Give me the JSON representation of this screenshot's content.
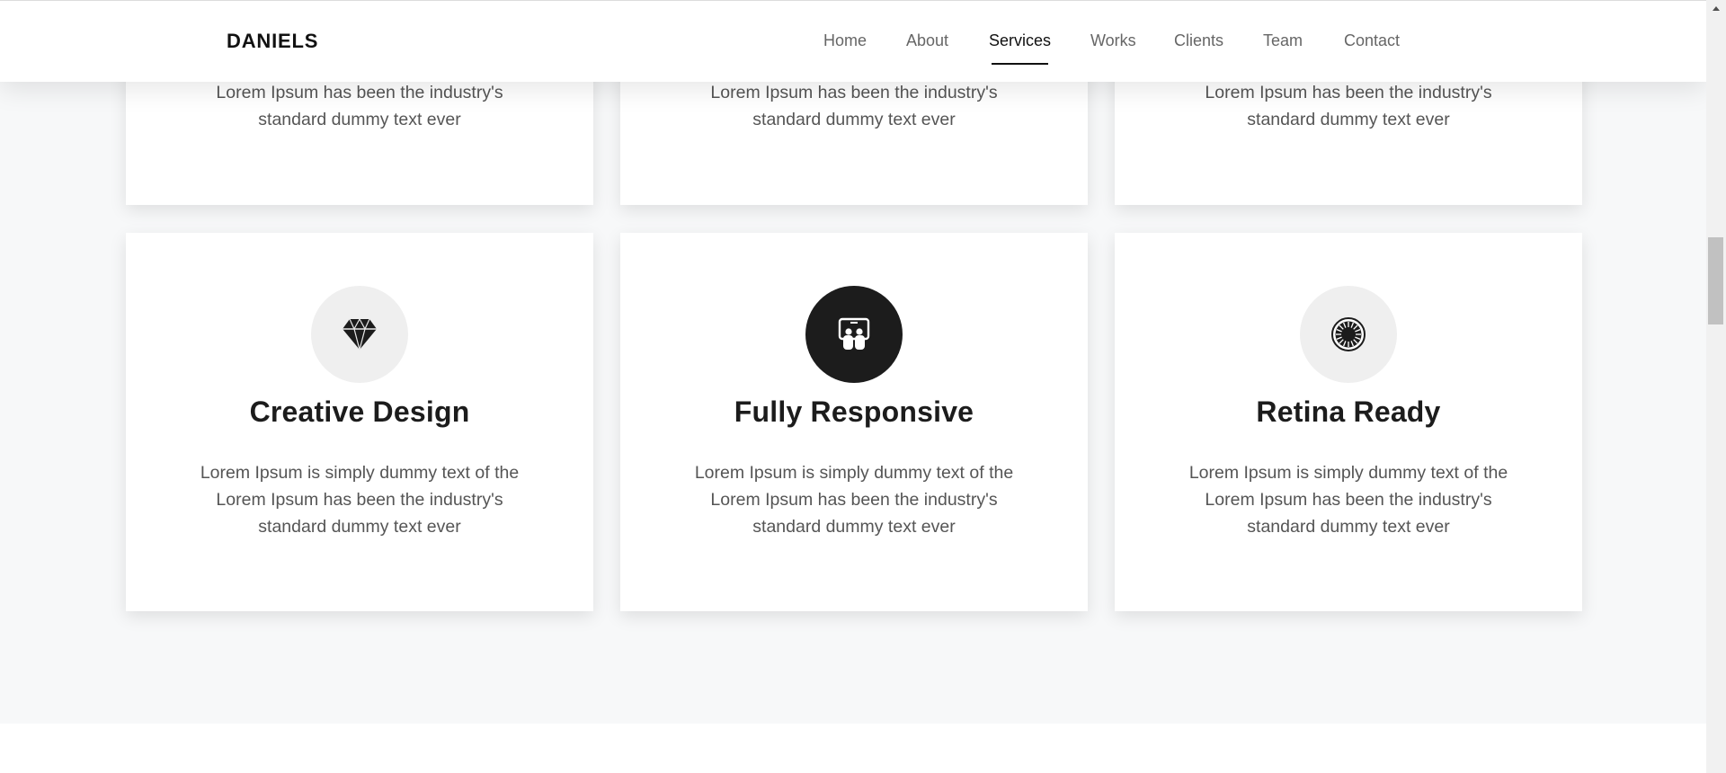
{
  "header": {
    "logo": "DANIELS",
    "nav": [
      {
        "label": "Home"
      },
      {
        "label": "About"
      },
      {
        "label": "Services",
        "active": true
      },
      {
        "label": "Works"
      },
      {
        "label": "Clients"
      },
      {
        "label": "Team"
      },
      {
        "label": "Contact"
      }
    ]
  },
  "services": {
    "top_row": [
      {
        "text": "Lorem Ipsum has been the industry's standard dummy text ever"
      },
      {
        "text": "Lorem Ipsum has been the industry's standard dummy text ever"
      },
      {
        "text": "Lorem Ipsum has been the industry's standard dummy text ever"
      }
    ],
    "cards": [
      {
        "title": "Creative Design",
        "text": "Lorem Ipsum is simply dummy text of the Lorem Ipsum has been the industry's standard dummy text ever",
        "icon": "diamond-icon"
      },
      {
        "title": "Fully Responsive",
        "text": "Lorem Ipsum is simply dummy text of the Lorem Ipsum has been the industry's standard dummy text ever",
        "icon": "responsive-devices-icon",
        "highlighted": true
      },
      {
        "title": "Retina Ready",
        "text": "Lorem Ipsum is simply dummy text of the Lorem Ipsum has been the industry's standard dummy text ever",
        "icon": "retina-eye-icon"
      }
    ]
  },
  "colors": {
    "section_background": "#f7f8f9",
    "card_background": "#ffffff",
    "heading": "#1c1c1c",
    "body_text": "#555555",
    "nav_text": "#666666",
    "nav_active": "#111111"
  }
}
